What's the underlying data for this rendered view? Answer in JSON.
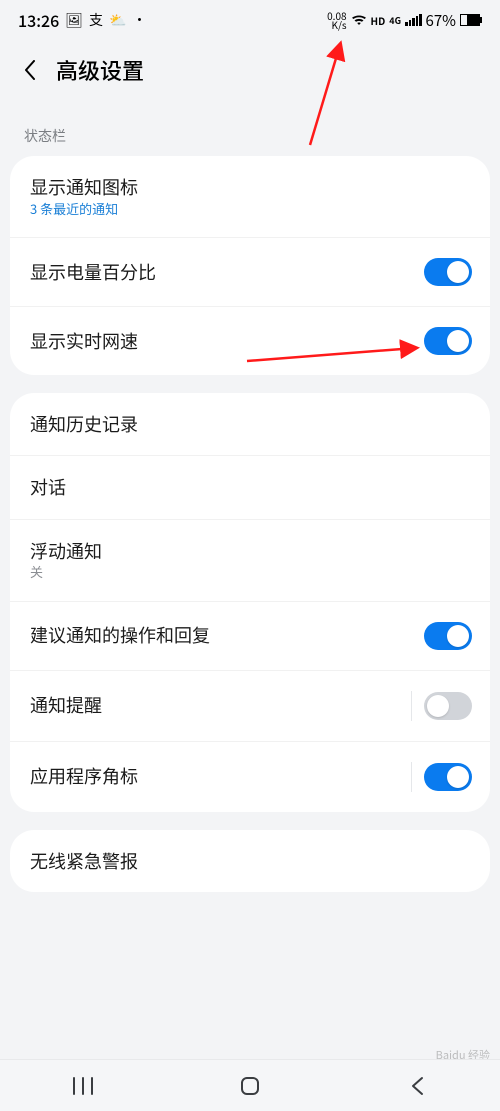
{
  "status": {
    "time": "13:26",
    "left_icons": [
      "image-icon",
      "pay-icon",
      "weather-icon",
      "dot-icon"
    ],
    "netspeed_top": "0.08",
    "netspeed_bottom": "K/s",
    "hd_label": "HD",
    "sig_label": "4G",
    "battery_pct": "67%"
  },
  "header": {
    "title": "高级设置"
  },
  "section_label": "状态栏",
  "card1": {
    "r0": {
      "title": "显示通知图标",
      "sub": "3 条最近的通知"
    },
    "r1": {
      "title": "显示电量百分比"
    },
    "r2": {
      "title": "显示实时网速"
    }
  },
  "card2": {
    "r0": {
      "title": "通知历史记录"
    },
    "r1": {
      "title": "对话"
    },
    "r2": {
      "title": "浮动通知",
      "sub": "关"
    },
    "r3": {
      "title": "建议通知的操作和回复"
    },
    "r4": {
      "title": "通知提醒"
    },
    "r5": {
      "title": "应用程序角标"
    }
  },
  "card3": {
    "r0": {
      "title": "无线紧急警报"
    }
  },
  "watermark": "Baidu 经验"
}
